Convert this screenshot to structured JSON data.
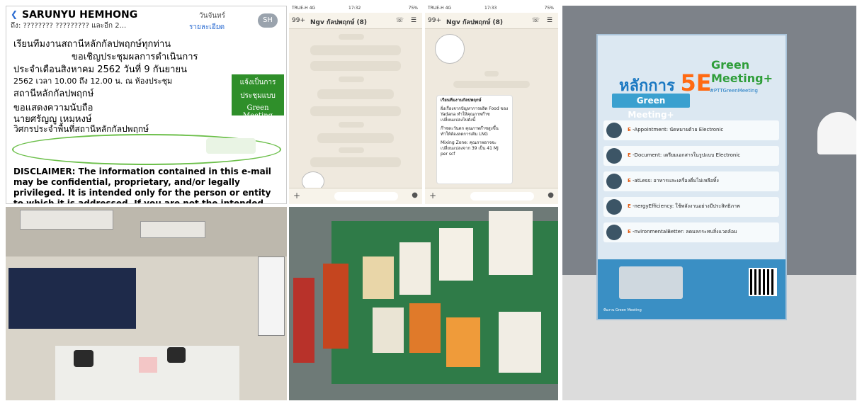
{
  "email": {
    "sender": "SARUNYU HEMHONG",
    "to": "ถึง: ???????? ????????? และอีก 2...",
    "date": "วันจันทร์",
    "detail_link": "รายละเอียด",
    "avatar": "SH",
    "body_lines": [
      "เรียนทีมงานสถานีหลักกัลปพฤกษ์ทุกท่าน",
      "ขอเชิญประชุมผลการดำเนินการ",
      "ประจำเดือนสิงหาคม 2562 วันที่ 9 กันยายน",
      "2562 เวลา 10.00 ถึง 12.00 น. ณ ห้องประชุม",
      "สถานีหลักกัลปพฤกษ์",
      "ขอแสดงความนับถือ",
      "นายศรัญญู เหมหงษ์",
      "วิศกรประจำพื้นที่สถานีหลักกัลปพฤกษ์"
    ],
    "green_box": [
      "แจ้งเป็นการ",
      "ประชุมแบบ",
      "Green Meeting"
    ],
    "disclaimer": "DISCLAIMER: The information contained in this e-mail may be confidential, proprietary, and/or legally privileged. It is intended only for the person or entity to which it is addressed. If you are not the intended recipient, you are not allowed to distribute, copy, review, retransmit, disseminate or use"
  },
  "chat1": {
    "carrier": "TRUE-H  4G",
    "time": "17:32",
    "battery": "75%",
    "title": "Ngv กัลปพฤกษ์ (8)",
    "back": "99+"
  },
  "chat2": {
    "carrier": "TRUE-H  4G",
    "time": "17:33",
    "battery": "75%",
    "title": "Ngv กัลปพฤกษ์ (8)",
    "back": "99+",
    "message_lines": [
      "เรียนทีมงานกัลปพฤกษ์",
      "ฝั่งเรื่องจากปัญหาการผลิต Food ของ",
      "Yadana ทำให้คุณภาพก๊าซ",
      "เปลี่ยนแปลงไปดังนี้",
      "ก๊าซตะวันตก คุณภาพก๊าซสูงขึ้น",
      "ทำให้ต้องลดการเติม LNG",
      "Mixing Zone: คุณภาพอาจจะ",
      "เปลี่ยนแปลงจาก 39 เป็น 41 MJ",
      "per scf"
    ]
  },
  "card": {
    "title_prefix": "หลักการ",
    "title_big": "5E",
    "subtitle": "Green Meeting+",
    "logo": "Green Meeting+",
    "hashtag": "#PTTGreenMeeting",
    "items": [
      {
        "letter": "E",
        "text": "-Appointment: นัดหมายด้วย Electronic"
      },
      {
        "letter": "E",
        "text": "-Document: เตรียมเอกสารในรูปแบบ Electronic"
      },
      {
        "letter": "E",
        "text": "-atLess: อาหารและเครื่องดื่มไม่เหลือทิ้ง"
      },
      {
        "letter": "E",
        "text": "-nergyEfficiency: ใช้พลังงานอย่างมีประสิทธิภาพ"
      },
      {
        "letter": "E",
        "text": "-nvironmentalBetter: ลดมลกระทบสิ่งแวดล้อม"
      }
    ],
    "footer": "ทีมงาน Green Meeting"
  },
  "colors": {
    "accent_orange": "#ff6a13",
    "brand_blue": "#1a78c2",
    "green": "#2f8f2a"
  }
}
